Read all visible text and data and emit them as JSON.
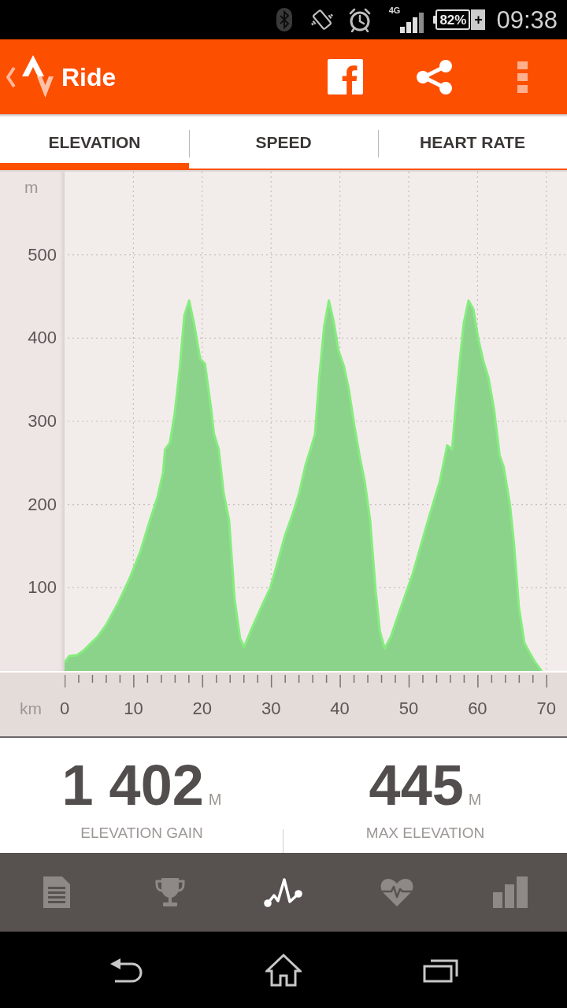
{
  "status_bar": {
    "network": "4G",
    "battery": "82%",
    "charging": "+",
    "time": "09:38"
  },
  "action_bar": {
    "title": "Ride"
  },
  "tabs": [
    {
      "label": "ELEVATION",
      "selected": true
    },
    {
      "label": "SPEED",
      "selected": false
    },
    {
      "label": "HEART RATE",
      "selected": false
    }
  ],
  "chart": {
    "chart_data": {
      "type": "area",
      "xlabel": "km",
      "ylabel": "m",
      "x": [
        0,
        0.7,
        1.8,
        2.7,
        3.8,
        4.8,
        6.1,
        7.8,
        9.5,
        11,
        12.4,
        13.5,
        14.3,
        14.6,
        15.3,
        16,
        16.7,
        17.4,
        18.1,
        18.8,
        19.7,
        20.4,
        21.3,
        21.7,
        22.4,
        23.1,
        23.9,
        24.7,
        25.5,
        26.1,
        27.2,
        28.6,
        29.9,
        30.9,
        32,
        33.2,
        34.1,
        35,
        35.9,
        36.4,
        37,
        37.7,
        38.4,
        39.1,
        39.8,
        40.6,
        41.3,
        42.1,
        42.9,
        43.6,
        44.4,
        45.2,
        45.8,
        46.5,
        47.4,
        48.4,
        49.5,
        50.6,
        51.5,
        52.5,
        53.5,
        54.5,
        55,
        55.6,
        56.3,
        56.8,
        57.4,
        58,
        58.7,
        59.4,
        60.1,
        60.9,
        61.6,
        62.4,
        63.2,
        63.8,
        64.7,
        65.3,
        66,
        66.8,
        67.7,
        68.4,
        69.3
      ],
      "values": [
        10,
        18,
        19,
        24,
        33,
        41,
        56,
        82,
        112,
        143,
        181,
        209,
        238,
        266,
        274,
        309,
        361,
        427,
        445,
        418,
        375,
        369,
        314,
        285,
        266,
        214,
        181,
        86,
        39,
        29,
        51,
        77,
        100,
        129,
        162,
        190,
        214,
        247,
        271,
        285,
        352,
        413,
        445,
        420,
        385,
        366,
        338,
        295,
        257,
        228,
        181,
        96,
        48,
        27,
        41,
        65,
        91,
        117,
        143,
        172,
        200,
        227,
        247,
        271,
        266,
        314,
        371,
        418,
        445,
        435,
        399,
        371,
        352,
        314,
        259,
        245,
        200,
        153,
        77,
        34,
        20,
        10,
        0
      ],
      "xlim": [
        0,
        73
      ],
      "ylim": [
        0,
        600
      ],
      "xticks": [
        0,
        10,
        20,
        30,
        40,
        50,
        60,
        70
      ],
      "yticks": [
        100,
        200,
        300,
        400,
        500
      ],
      "grid": true
    }
  },
  "stats": [
    {
      "value": "1 402",
      "unit": "M",
      "label": "ELEVATION GAIN"
    },
    {
      "value": "445",
      "unit": "M",
      "label": "MAX ELEVATION"
    }
  ],
  "bottom_nav": [
    {
      "kind": "summary",
      "selected": false
    },
    {
      "kind": "achievements",
      "selected": false
    },
    {
      "kind": "elevation",
      "selected": true
    },
    {
      "kind": "heart_rate",
      "selected": false
    },
    {
      "kind": "analysis",
      "selected": false
    }
  ]
}
